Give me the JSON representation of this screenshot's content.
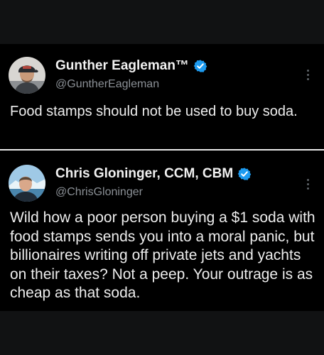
{
  "tweets": [
    {
      "display_name": "Gunther Eagleman™",
      "handle": "@GuntherEagleman",
      "verified": true,
      "text": "Food stamps should not be used to buy soda.",
      "avatar": "profile-photo-man-in-cap",
      "more_icon": "vertical-ellipsis-icon"
    },
    {
      "display_name": "Chris Gloninger, CCM, CBM",
      "handle": "@ChrisGloninger",
      "verified": true,
      "text": "Wild how a poor person buying a $1 soda with food stamps sends you into a moral panic, but billionaires writing off private jets and yachts on their taxes? Not a peep. Your outrage is as cheap as that soda.",
      "avatar": "profile-photo-man-with-glacier",
      "more_icon": "vertical-ellipsis-icon"
    }
  ],
  "colors": {
    "background": "#000000",
    "band": "#111213",
    "divider": "#e9e9e9",
    "verified_badge": "#1d9bf0",
    "handle_gray": "#8b9096"
  }
}
